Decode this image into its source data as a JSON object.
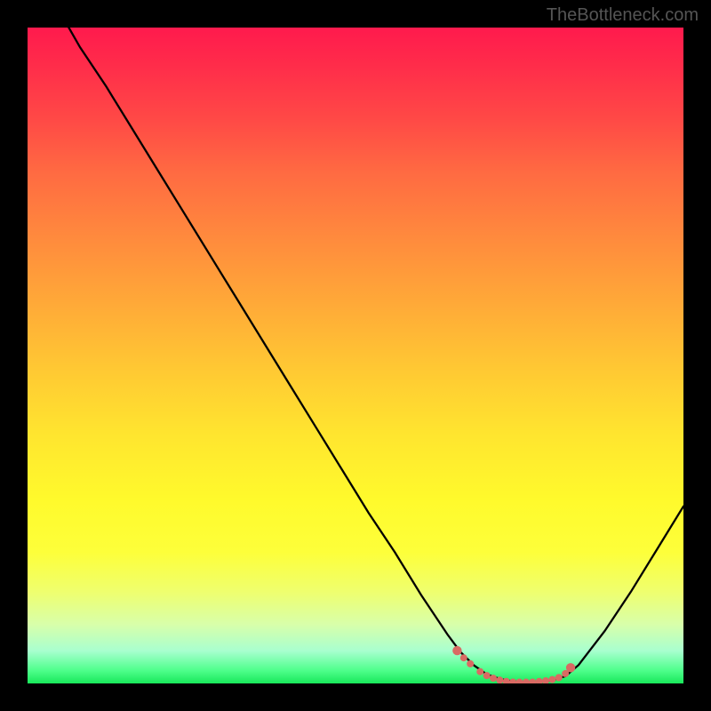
{
  "watermark": "TheBottleneck.com",
  "chart_data": {
    "type": "line",
    "title": "",
    "xlabel": "",
    "ylabel": "",
    "xlim": [
      0,
      100
    ],
    "ylim": [
      0,
      100
    ],
    "series": [
      {
        "name": "bottleneck-curve",
        "x": [
          0,
          4,
          8,
          12,
          16,
          20,
          24,
          28,
          32,
          36,
          40,
          44,
          48,
          52,
          56,
          60,
          64,
          66,
          68,
          70,
          72,
          74,
          76,
          78,
          80,
          82,
          84,
          88,
          92,
          96,
          100
        ],
        "values": [
          112,
          104,
          97,
          91,
          84.5,
          78,
          71.5,
          65,
          58.5,
          52,
          45.5,
          39,
          32.5,
          26,
          20,
          13.5,
          7.5,
          4.8,
          2.8,
          1.4,
          0.7,
          0.3,
          0.2,
          0.2,
          0.5,
          1.1,
          2.8,
          8,
          14,
          20.5,
          27
        ]
      }
    ],
    "markers": {
      "name": "optimal-range-dots",
      "color": "#d96a63",
      "x": [
        65.5,
        66.5,
        67.5,
        69,
        70,
        71,
        72,
        73,
        74,
        75,
        76,
        77,
        78,
        79,
        80,
        81,
        82,
        82.8
      ],
      "values": [
        5.0,
        3.9,
        3.0,
        1.8,
        1.2,
        0.8,
        0.5,
        0.3,
        0.2,
        0.2,
        0.2,
        0.2,
        0.3,
        0.4,
        0.6,
        0.9,
        1.5,
        2.4
      ]
    },
    "gradient_stops": [
      {
        "pos": 0,
        "color": "#ff1a4d"
      },
      {
        "pos": 40,
        "color": "#ff9a3b"
      },
      {
        "pos": 72,
        "color": "#fffa2c"
      },
      {
        "pos": 100,
        "color": "#18e85a"
      }
    ]
  }
}
